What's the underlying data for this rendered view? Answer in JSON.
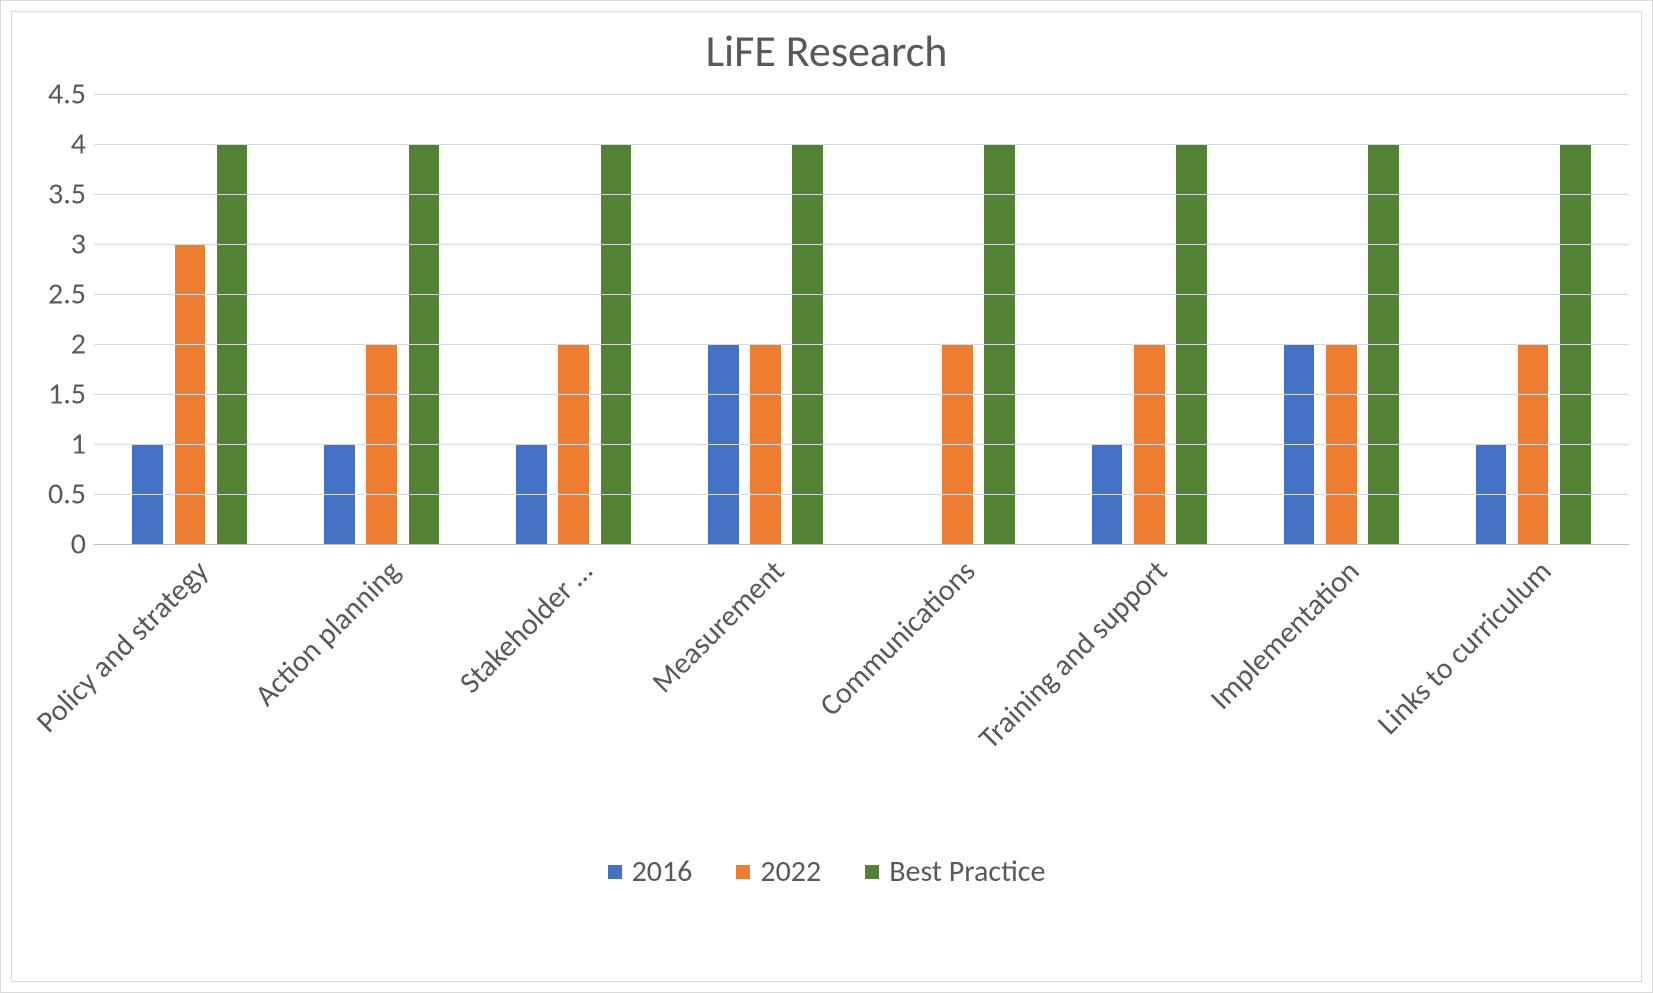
{
  "chart_data": {
    "type": "bar",
    "title": "LiFE Research",
    "xlabel": "",
    "ylabel": "",
    "ylim": [
      0,
      4.5
    ],
    "y_ticks": [
      0,
      0.5,
      1,
      1.5,
      2,
      2.5,
      3,
      3.5,
      4,
      4.5
    ],
    "categories": [
      "Policy and strategy",
      "Action planning",
      "Stakeholder …",
      "Measurement",
      "Communications",
      "Training and support",
      "Implementation",
      "Links to curriculum"
    ],
    "series": [
      {
        "name": "2016",
        "color": "#4472c4",
        "values": [
          1,
          1,
          1,
          2,
          0,
          1,
          2,
          1
        ]
      },
      {
        "name": "2022",
        "color": "#ed7d31",
        "values": [
          3,
          2,
          2,
          2,
          2,
          2,
          2,
          2
        ]
      },
      {
        "name": "Best Practice",
        "color": "#548235",
        "values": [
          4,
          4,
          4,
          4,
          4,
          4,
          4,
          4
        ]
      }
    ],
    "legend_position": "bottom",
    "grid": true
  }
}
